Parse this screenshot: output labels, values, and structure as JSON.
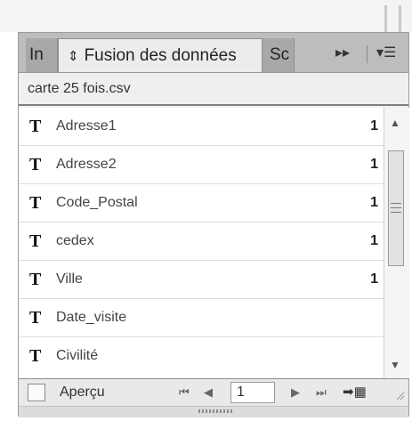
{
  "tabs": [
    {
      "label": "In"
    },
    {
      "label": "Fusion des données"
    },
    {
      "label": "Sc"
    }
  ],
  "icons": {
    "expand": "double-chevron-right",
    "menu": "panel-menu",
    "field_type": "T"
  },
  "data_source": {
    "filename": "carte 25 fois.csv"
  },
  "fields": [
    {
      "type": "T",
      "name": "Adresse1",
      "count": "1"
    },
    {
      "type": "T",
      "name": "Adresse2",
      "count": "1"
    },
    {
      "type": "T",
      "name": "Code_Postal",
      "count": "1"
    },
    {
      "type": "T",
      "name": "cedex",
      "count": "1"
    },
    {
      "type": "T",
      "name": "Ville",
      "count": "1"
    },
    {
      "type": "T",
      "name": "Date_visite",
      "count": ""
    },
    {
      "type": "T",
      "name": "Civilité",
      "count": ""
    }
  ],
  "footer": {
    "preview_label": "Aperçu",
    "preview_checked": false,
    "page_value": "1"
  },
  "colors": {
    "tabbar": "#bdbdbd",
    "active_tab": "#ececec",
    "list_bg": "#ffffff",
    "panel_bg": "#efefef"
  }
}
